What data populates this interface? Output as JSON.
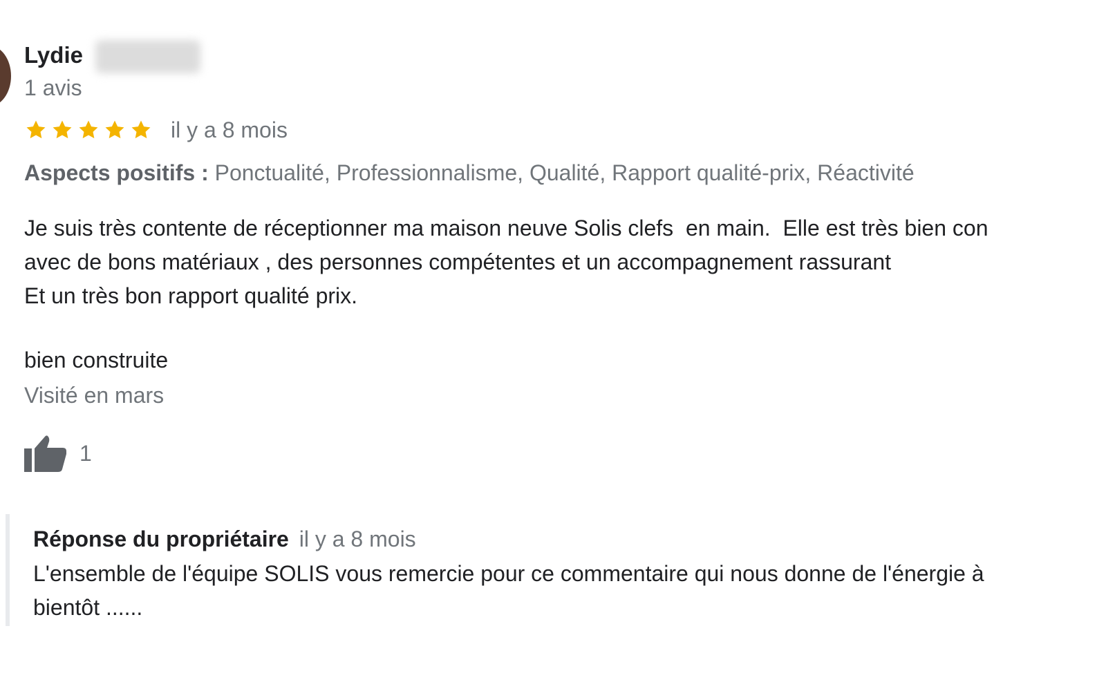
{
  "review": {
    "reviewer_name": "Lydie",
    "review_count": "1 avis",
    "rating": 5,
    "date": "il y a 8 mois",
    "aspects_label": "Aspects positifs :",
    "aspects_values": "Ponctualité, Professionnalisme, Qualité, Rapport qualité-prix, Réactivité",
    "text": "Je suis très contente de réceptionner ma maison neuve Solis clefs  en main.  Elle est très bien con\navec de bons matériaux , des personnes compétentes et un accompagnement rassurant\nEt un très bon rapport qualité prix.",
    "extra": "bien construite",
    "visit": "Visité en mars",
    "likes": "1",
    "star_color": "#f4b400",
    "like_icon": "thumb-up-icon"
  },
  "owner_reply": {
    "title": "Réponse du propriétaire",
    "date": "il y a 8 mois",
    "text": "L'ensemble de l'équipe SOLIS vous remercie pour ce commentaire qui nous donne de l'énergie à\nbientôt ......"
  }
}
